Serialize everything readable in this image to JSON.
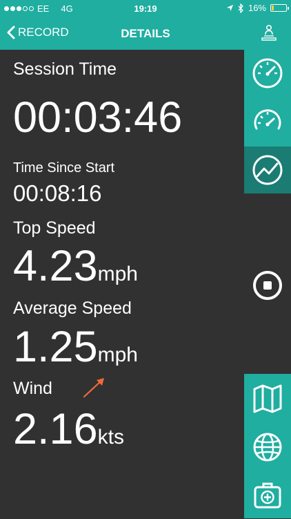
{
  "status_bar": {
    "carrier": "EE",
    "network": "4G",
    "time": "19:19",
    "battery": "16%",
    "battery_level": 0.16,
    "signal_bars": 3,
    "signal_max": 5
  },
  "nav": {
    "back_label": "RECORD",
    "title": "DETAILS"
  },
  "stats": {
    "session_time_label": "Session Time",
    "session_time": "00:03:46",
    "time_since_start_label": "Time Since Start",
    "time_since_start": "00:08:16",
    "top_speed_label": "Top Speed",
    "top_speed": "4.23",
    "top_speed_unit": "mph",
    "average_speed_label": "Average Speed",
    "average_speed": "1.25",
    "average_speed_unit": "mph",
    "wind_label": "Wind",
    "wind_speed": "2.16",
    "wind_unit": "kts"
  },
  "colors": {
    "teal": "#1faea0",
    "teal_active": "#1a7c73",
    "background": "#313131",
    "wind_arrow": "#f06a3a",
    "battery_fill": "#f3d13a"
  },
  "icons": {
    "sidebar_top": [
      "speedometer-icon",
      "speedometer-alt-icon",
      "chart-line-icon"
    ],
    "sidebar_bottom": [
      "map-icon",
      "globe-icon",
      "first-aid-kit-icon"
    ],
    "stop": "stop-icon"
  }
}
